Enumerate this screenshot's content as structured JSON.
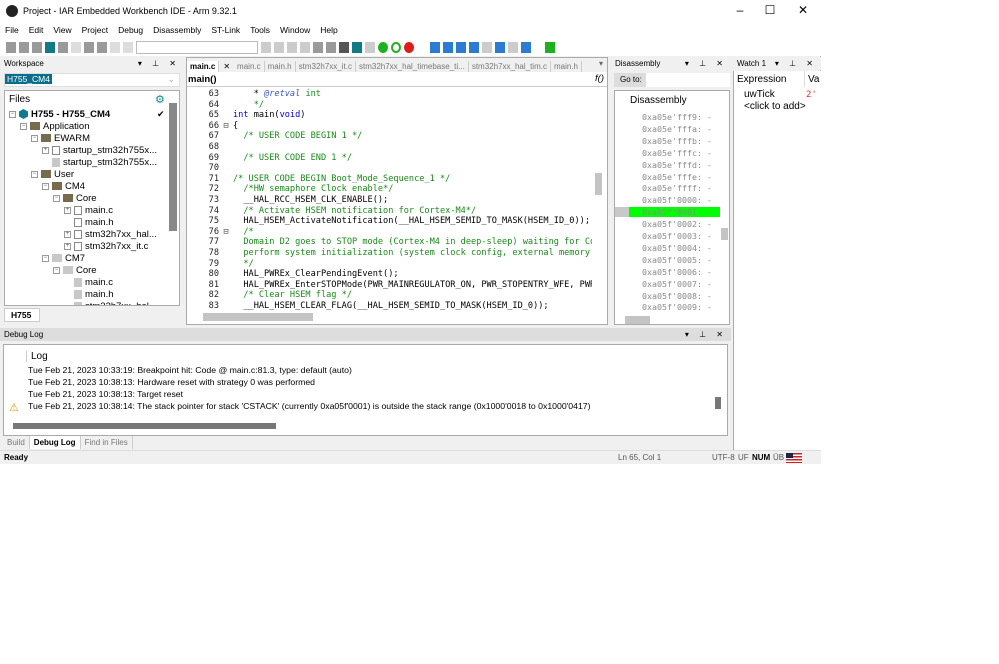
{
  "window": {
    "title": "Project - IAR Embedded Workbench IDE - Arm 9.32.1"
  },
  "menu": [
    "File",
    "Edit",
    "View",
    "Project",
    "Debug",
    "Disassembly",
    "ST-Link",
    "Tools",
    "Window",
    "Help"
  ],
  "workspace": {
    "title": "Workspace",
    "config": "H755_CM4",
    "files_label": "Files",
    "bottom_tab": "H755",
    "tree": [
      {
        "label": "H755 - H755_CM4",
        "depth": 0,
        "kind": "project",
        "bold": true,
        "check": "✔"
      },
      {
        "label": "Application",
        "depth": 1,
        "kind": "folder"
      },
      {
        "label": "EWARM",
        "depth": 2,
        "kind": "folder"
      },
      {
        "label": "startup_stm32h755x...",
        "depth": 3,
        "kind": "file",
        "expand": true
      },
      {
        "label": "startup_stm32h755x...",
        "depth": 3,
        "kind": "file-grey"
      },
      {
        "label": "User",
        "depth": 2,
        "kind": "folder"
      },
      {
        "label": "CM4",
        "depth": 3,
        "kind": "folder"
      },
      {
        "label": "Core",
        "depth": 4,
        "kind": "folder"
      },
      {
        "label": "main.c",
        "depth": 5,
        "kind": "file",
        "expand": true
      },
      {
        "label": "main.h",
        "depth": 5,
        "kind": "file"
      },
      {
        "label": "stm32h7xx_hal...",
        "depth": 5,
        "kind": "file",
        "expand": true
      },
      {
        "label": "stm32h7xx_it.c",
        "depth": 5,
        "kind": "file",
        "expand": true
      },
      {
        "label": "CM7",
        "depth": 3,
        "kind": "folder-grey"
      },
      {
        "label": "Core",
        "depth": 4,
        "kind": "folder-grey"
      },
      {
        "label": "main.c",
        "depth": 5,
        "kind": "file-grey"
      },
      {
        "label": "main.h",
        "depth": 5,
        "kind": "file-grey"
      },
      {
        "label": "stm32h7xx_hal...",
        "depth": 5,
        "kind": "file-grey"
      }
    ]
  },
  "editor": {
    "tabs": [
      "main.c",
      "main.c",
      "main.h",
      "stm32h7xx_it.c",
      "stm32h7xx_hal_timebase_ti...",
      "stm32h7xx_hal_tim.c",
      "main.h"
    ],
    "active_tab": 0,
    "function": "main()",
    "func_icon": "f()",
    "lines": [
      {
        "n": "63",
        "s": [
          [
            "    * ",
            ""
          ],
          [
            "@retval",
            "doc"
          ],
          [
            " int",
            "cm"
          ]
        ]
      },
      {
        "n": "64",
        "s": [
          [
            "    */",
            "cm"
          ]
        ]
      },
      {
        "n": "65",
        "s": [
          [
            "int",
            "kw"
          ],
          [
            " main(",
            ""
          ],
          [
            "void",
            "kw"
          ],
          [
            ")",
            ""
          ]
        ]
      },
      {
        "n": "66",
        "s": [
          [
            "{",
            ""
          ]
        ],
        "fold": true
      },
      {
        "n": "67",
        "s": [
          [
            "  /* USER CODE BEGIN 1 */",
            "cm"
          ]
        ]
      },
      {
        "n": "68",
        "s": []
      },
      {
        "n": "69",
        "s": [
          [
            "  /* USER CODE END 1 */",
            "cm"
          ]
        ]
      },
      {
        "n": "70",
        "s": []
      },
      {
        "n": "71",
        "s": [
          [
            "/* USER CODE BEGIN Boot_Mode_Sequence_1 */",
            "cm"
          ]
        ]
      },
      {
        "n": "72",
        "s": [
          [
            "  /*HW semaphore Clock enable*/",
            "cm"
          ]
        ]
      },
      {
        "n": "73",
        "s": [
          [
            "  __HAL_RCC_HSEM_CLK_ENABLE();",
            ""
          ]
        ]
      },
      {
        "n": "74",
        "s": [
          [
            "  /* Activate HSEM notification for Cortex-M4*/",
            "cm"
          ]
        ]
      },
      {
        "n": "75",
        "s": [
          [
            "  HAL_HSEM_ActivateNotification(__HAL_HSEM_SEMID_TO_MASK(HSEM_ID_0));",
            ""
          ]
        ]
      },
      {
        "n": "76",
        "s": [
          [
            "  /*",
            "cm"
          ]
        ],
        "fold": true
      },
      {
        "n": "77",
        "s": [
          [
            "  Domain D2 goes to STOP mode (Cortex-M4 in deep-sleep) waiting for Corte",
            "cm"
          ]
        ]
      },
      {
        "n": "78",
        "s": [
          [
            "  perform system initialization (system clock config, external memory con",
            "cm"
          ]
        ]
      },
      {
        "n": "79",
        "s": [
          [
            "  */",
            "cm"
          ]
        ]
      },
      {
        "n": "80",
        "s": [
          [
            "  HAL_PWREx_ClearPendingEvent();",
            ""
          ]
        ]
      },
      {
        "n": "81",
        "s": [
          [
            "  HAL_PWREx_EnterSTOPMode(PWR_MAINREGULATOR_ON, PWR_STOPENTRY_WFE, PWR_D2_",
            ""
          ]
        ]
      },
      {
        "n": "82",
        "s": [
          [
            "  /* Clear HSEM flag */",
            "cm"
          ]
        ]
      },
      {
        "n": "83",
        "s": [
          [
            "  __HAL_HSEM_CLEAR_FLAG(__HAL_HSEM_SEMID_TO_MASK(HSEM_ID_0));",
            ""
          ]
        ]
      }
    ]
  },
  "disassembly": {
    "title": "Disassembly",
    "goto_label": "Go to:",
    "header": "Disassembly",
    "highlight_color": "#00ff00",
    "current": 8,
    "rows": [
      "0xa05e'fff9: -",
      "0xa05e'fffa: -",
      "0xa05e'fffb: -",
      "0xa05e'fffc: -",
      "0xa05e'fffd: -",
      "0xa05e'fffe: -",
      "0xa05e'ffff: -",
      "0xa05f'0000: -",
      "0xa05f'0001: -",
      "0xa05f'0002: -",
      "0xa05f'0003: -",
      "0xa05f'0004: -",
      "0xa05f'0005: -",
      "0xa05f'0006: -",
      "0xa05f'0007: -",
      "0xa05f'0008: -",
      "0xa05f'0009: -"
    ]
  },
  "watch": {
    "title": "Watch 1",
    "col_expression": "Expression",
    "col_value": "Va",
    "rows": [
      {
        "expr": "uwTick",
        "value": "2'"
      }
    ],
    "add_label": "<click to add>"
  },
  "debug_log": {
    "title": "Debug Log",
    "header": "Log",
    "entries": [
      {
        "text": "Tue Feb 21, 2023 10:33:19: Breakpoint hit: Code @ main.c:81.3, type: default (auto)",
        "warn": false
      },
      {
        "text": "Tue Feb 21, 2023 10:38:13: Hardware reset with strategy 0 was performed",
        "warn": false
      },
      {
        "text": "Tue Feb 21, 2023 10:38:13: Target reset",
        "warn": false
      },
      {
        "text": "Tue Feb 21, 2023 10:38:14: The stack pointer for stack 'CSTACK' (currently 0xa05f'0001) is outside the stack range (0x1000'0018 to 0x1000'0417)",
        "warn": true
      }
    ],
    "tabs": [
      "Build",
      "Debug Log",
      "Find in Files"
    ],
    "active_tab": 1
  },
  "status": {
    "ready": "Ready",
    "position": "Ln 65, Col 1",
    "encoding": "UTF-8",
    "uf": "UF",
    "num": "NUM",
    "ub": "ÜB"
  }
}
